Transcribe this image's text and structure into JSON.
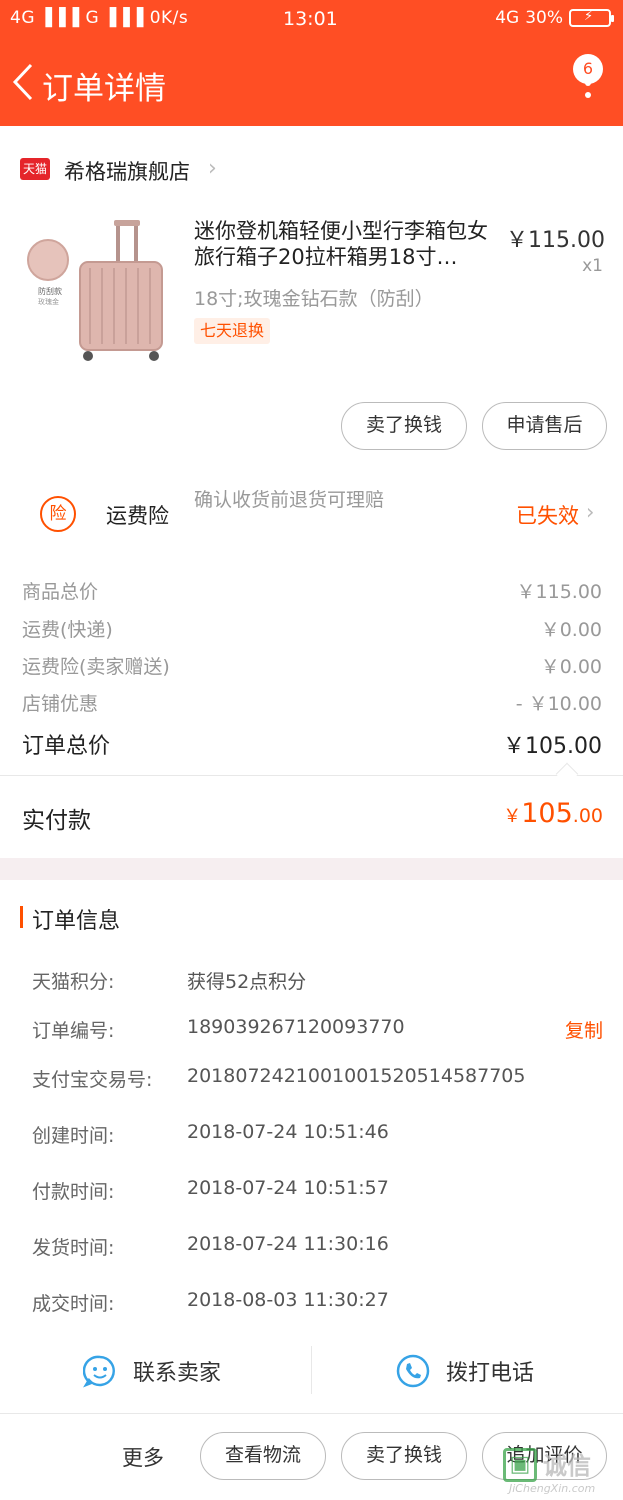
{
  "status_bar": {
    "left": "4G ▐▐▐ G ▐▐▐ 0K/s",
    "time": "13:01",
    "network": "4G",
    "battery": "30%"
  },
  "header": {
    "title": "订单详情",
    "badge_count": "6"
  },
  "store": {
    "logo_text": "天猫",
    "name": "希格瑞旗舰店"
  },
  "product": {
    "title": "迷你登机箱轻便小型行李箱包女旅行箱子20拉杆箱男18寸…",
    "price": "￥115.00",
    "qty": "x1",
    "sku": "18寸;玫瑰金钻石款（防刮）",
    "tag": "七天退换",
    "thumb_label_1": "防刮款",
    "thumb_label_2": "玫瑰金",
    "product_color": "#d9b0a8"
  },
  "item_actions": {
    "sell": "卖了换钱",
    "aftersale": "申请售后"
  },
  "insurance": {
    "icon_text": "险",
    "label": "运费险",
    "desc": "确认收货前退货可理赔",
    "status": "已失效"
  },
  "price_breakdown": [
    {
      "label": "商品总价",
      "value": "￥115.00"
    },
    {
      "label": "运费(快递)",
      "value": "￥0.00"
    },
    {
      "label": "运费险(卖家赠送)",
      "value": "￥0.00"
    },
    {
      "label": "店铺优惠",
      "value": "- ￥10.00"
    }
  ],
  "total": {
    "label": "订单总价",
    "value": "￥105.00"
  },
  "paid": {
    "label": "实付款",
    "currency": "￥",
    "integer": "105",
    "decimal": ".00"
  },
  "order_info": {
    "title": "订单信息",
    "copy_label": "复制",
    "rows": [
      {
        "key": "天猫积分:",
        "value": "获得52点积分"
      },
      {
        "key": "订单编号:",
        "value": "189039267120093770"
      },
      {
        "key": "支付宝交易号:",
        "value": "2018072421001001520514587705"
      },
      {
        "key": "创建时间:",
        "value": "2018-07-24 10:51:46"
      },
      {
        "key": "付款时间:",
        "value": "2018-07-24 10:51:57"
      },
      {
        "key": "发货时间:",
        "value": "2018-07-24 11:30:16"
      },
      {
        "key": "成交时间:",
        "value": "2018-08-03 11:30:27"
      }
    ]
  },
  "contact": {
    "seller": "联系卖家",
    "phone": "拨打电话"
  },
  "bottom_bar": {
    "more": "更多",
    "logistics": "查看物流",
    "sell": "卖了换钱",
    "review": "追加评价"
  },
  "watermark": {
    "name": "诚信",
    "domain": "JiChengXin.com"
  },
  "colors": {
    "brand": "#ff4e24",
    "accent": "#ff5000"
  }
}
